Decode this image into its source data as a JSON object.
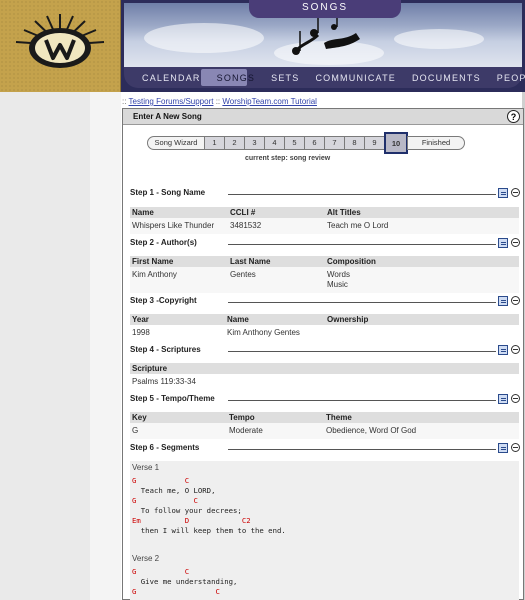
{
  "header": {
    "page_title": "SONGS",
    "nav": [
      "CALENDAR",
      "SONGS",
      "SETS",
      "COMMUNICATE",
      "DOCUMENTS",
      "PEOPLE"
    ],
    "active_nav": "SONGS"
  },
  "breadcrumb": {
    "prefix": "::",
    "link1": "Testing Forums/Support",
    "sep": "::",
    "link2": "WorshipTeam.com Tutorial"
  },
  "panel": {
    "title": "Enter A New Song",
    "help": "?"
  },
  "wizard": {
    "label": "Song Wizard",
    "steps": [
      "1",
      "2",
      "3",
      "4",
      "5",
      "6",
      "7",
      "8",
      "9"
    ],
    "current": "10",
    "finish": "Finished",
    "status": "current step: song review"
  },
  "step1": {
    "title": "Step 1 - Song Name",
    "headers": [
      "Name",
      "CCLI #",
      "Alt Titles"
    ],
    "row": [
      "Whispers Like Thunder",
      "3481532",
      "Teach me O Lord"
    ]
  },
  "step2": {
    "title": "Step 2 - Author(s)",
    "headers": [
      "First Name",
      "Last Name",
      "Composition"
    ],
    "row": [
      "Kim Anthony",
      "Gentes",
      "Words",
      "Music"
    ]
  },
  "step3": {
    "title": "Step 3 -Copyright",
    "headers": [
      "Year",
      "Name",
      "Ownership"
    ],
    "row": [
      "1998",
      "Kim Anthony Gentes",
      ""
    ]
  },
  "step4": {
    "title": "Step 4 - Scriptures",
    "headers": [
      "Scripture"
    ],
    "row": [
      "Psalms 119:33-34"
    ]
  },
  "step5": {
    "title": "Step 5 - Tempo/Theme",
    "headers": [
      "Key",
      "Tempo",
      "Theme"
    ],
    "row": [
      "G",
      "Moderate",
      "Obedience, Word Of God"
    ]
  },
  "step6": {
    "title": "Step 6 - Segments",
    "verse1": {
      "title": "Verse 1",
      "lines": [
        "G           C",
        "  Teach me, O LORD,",
        "G             C",
        "  To follow your decrees;",
        "Em          D            C2",
        "  then I will keep them to the end."
      ]
    },
    "verse2": {
      "title": "Verse 2",
      "lines": [
        "G           C",
        "  Give me understanding,",
        "G                  C"
      ]
    }
  }
}
